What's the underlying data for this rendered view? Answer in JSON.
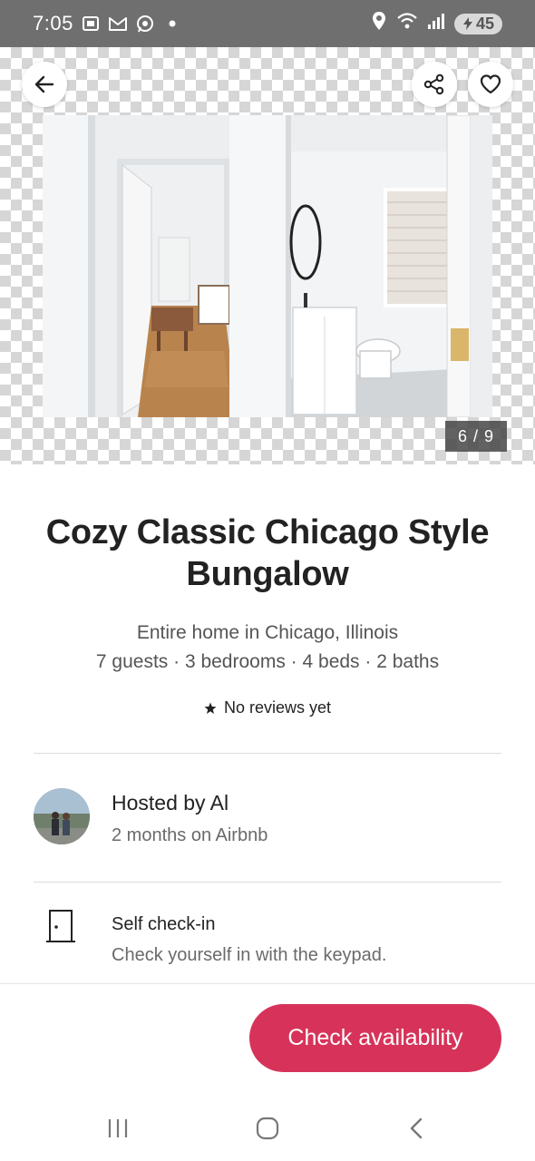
{
  "status_bar": {
    "time": "7:05",
    "notification_icons": [
      "screenshot-icon",
      "gmail-icon",
      "whatsapp-icon",
      "dot-icon"
    ],
    "system_icons": [
      "location-icon",
      "wifi-icon",
      "signal-icon"
    ],
    "battery": "45"
  },
  "gallery": {
    "counter": "6 / 9"
  },
  "listing": {
    "title": "Cozy Classic Chicago Style Bungalow",
    "location": "Entire home in Chicago, Illinois",
    "details": "7 guests · 3 bedrooms · 4 beds · 2 baths",
    "reviews": "No reviews yet"
  },
  "host": {
    "name": "Hosted by Al",
    "tenure": "2 months on Airbnb"
  },
  "features": [
    {
      "icon": "door-icon",
      "title": "Self check-in",
      "subtitle": "Check yourself in with the keypad."
    }
  ],
  "action": {
    "button_label": "Check availability",
    "button_color": "#d7335a"
  },
  "nav": {
    "buttons": [
      "recents-icon",
      "home-icon",
      "back-icon"
    ]
  }
}
